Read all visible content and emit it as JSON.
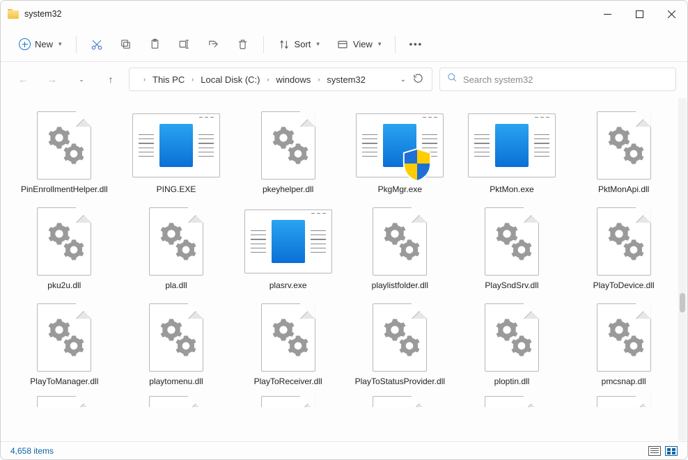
{
  "window": {
    "title": "system32"
  },
  "toolbar": {
    "new_label": "New",
    "sort_label": "Sort",
    "view_label": "View"
  },
  "breadcrumb": [
    "This PC",
    "Local Disk (C:)",
    "windows",
    "system32"
  ],
  "search": {
    "placeholder": "Search system32"
  },
  "files": [
    {
      "name": "PinEnrollmentHelper.dll",
      "kind": "dll"
    },
    {
      "name": "PING.EXE",
      "kind": "exe"
    },
    {
      "name": "pkeyhelper.dll",
      "kind": "dll"
    },
    {
      "name": "PkgMgr.exe",
      "kind": "exe_shield"
    },
    {
      "name": "PktMon.exe",
      "kind": "exe"
    },
    {
      "name": "PktMonApi.dll",
      "kind": "dll"
    },
    {
      "name": "pku2u.dll",
      "kind": "dll"
    },
    {
      "name": "pla.dll",
      "kind": "dll"
    },
    {
      "name": "plasrv.exe",
      "kind": "exe"
    },
    {
      "name": "playlistfolder.dll",
      "kind": "dll"
    },
    {
      "name": "PlaySndSrv.dll",
      "kind": "dll"
    },
    {
      "name": "PlayToDevice.dll",
      "kind": "dll"
    },
    {
      "name": "PlayToManager.dll",
      "kind": "dll"
    },
    {
      "name": "playtomenu.dll",
      "kind": "dll"
    },
    {
      "name": "PlayToReceiver.dll",
      "kind": "dll"
    },
    {
      "name": "PlayToStatusProvider.dll",
      "kind": "dll"
    },
    {
      "name": "ploptin.dll",
      "kind": "dll"
    },
    {
      "name": "pmcsnap.dll",
      "kind": "dll"
    }
  ],
  "status": {
    "item_count": "4,658 items"
  }
}
